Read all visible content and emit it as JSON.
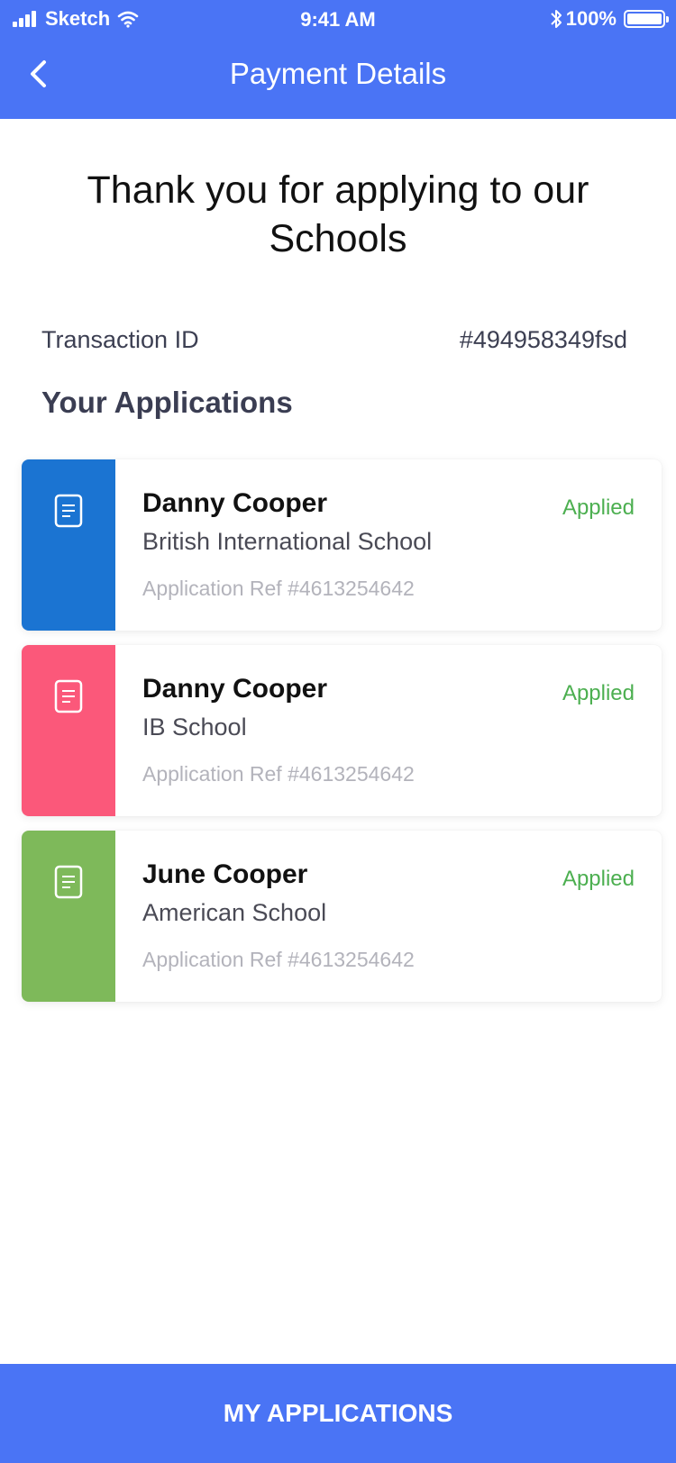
{
  "status_bar": {
    "carrier": "Sketch",
    "time": "9:41 AM",
    "battery": "100%"
  },
  "nav": {
    "back_icon": "chevron-left-icon",
    "title": "Payment Details"
  },
  "thank_you": "Thank you for applying to our Schools",
  "transaction": {
    "label": "Transaction ID",
    "value": "#494958349fsd"
  },
  "applications_title": "Your Applications",
  "applications": [
    {
      "name": "Danny Cooper",
      "school": "British International School",
      "ref": "Application Ref #4613254642",
      "status": "Applied",
      "accent": "#1b74d2",
      "icon": "document-icon"
    },
    {
      "name": "Danny Cooper",
      "school": "IB School",
      "ref": "Application Ref #4613254642",
      "status": "Applied",
      "accent": "#fb587a",
      "icon": "document-icon"
    },
    {
      "name": "June Cooper",
      "school": "American School",
      "ref": "Application Ref #4613254642",
      "status": "Applied",
      "accent": "#7eb95a",
      "icon": "document-icon"
    }
  ],
  "bottom_button": "MY APPLICATIONS",
  "colors": {
    "primary": "#4a74f5",
    "status_applied": "#4caf50"
  }
}
